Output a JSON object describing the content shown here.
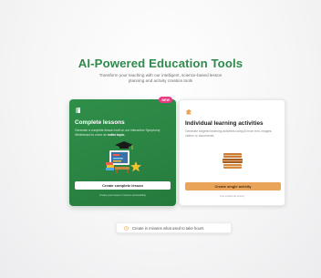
{
  "header": {
    "title": "AI-Powered Education Tools",
    "subtitle": "Transform your teaching with our intelligent, science-based lesson planning and activity creation tools"
  },
  "cards": {
    "complete": {
      "badge": "NEW",
      "title": "Complete lessons",
      "description": "Generate a complete lesson built on our interactive Symphony Whiteboard to cover an ",
      "description_emphasis": "entire topic.",
      "button_label": "Create complete lesson",
      "note": "Create your lesson in lesson accessibility",
      "icon": "book-icon",
      "illustration": "classroom-illustration-icon"
    },
    "individual": {
      "title": "Individual learning activities",
      "description": "Generate targeted learning activities using AI from text, images, videos or documents.",
      "button_label": "Create single activity",
      "note": "One traditional activity",
      "icon": "puzzle-icon",
      "illustration": "stacked-books-icon"
    }
  },
  "footer": {
    "pill_text": "Create in minutes what used to take hours",
    "icon": "clock-icon"
  },
  "colors": {
    "title_green": "#2f8a4c",
    "card_green": "#2a8343",
    "badge_pink": "#e73c84",
    "button_orange": "#e9a45a"
  }
}
